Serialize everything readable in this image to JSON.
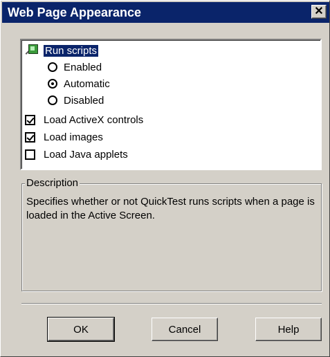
{
  "window": {
    "title": "Web Page Appearance",
    "close_glyph": "✕"
  },
  "options": {
    "run_scripts": {
      "label": "Run scripts",
      "icon": "tree-node-icon"
    },
    "radios": [
      {
        "label": "Enabled",
        "checked": false
      },
      {
        "label": "Automatic",
        "checked": true
      },
      {
        "label": "Disabled",
        "checked": false
      }
    ],
    "checkboxes": [
      {
        "label": "Load ActiveX controls",
        "checked": true
      },
      {
        "label": "Load images",
        "checked": true
      },
      {
        "label": "Load Java applets",
        "checked": false
      }
    ]
  },
  "description": {
    "label": "Description",
    "text": "Specifies whether or not QuickTest runs scripts when a page is loaded in the Active Screen."
  },
  "buttons": {
    "ok": "OK",
    "cancel": "Cancel",
    "help": "Help"
  },
  "colors": {
    "titlebar": "#0a246a",
    "face": "#d4d0c8",
    "selection": "#0a246a"
  }
}
